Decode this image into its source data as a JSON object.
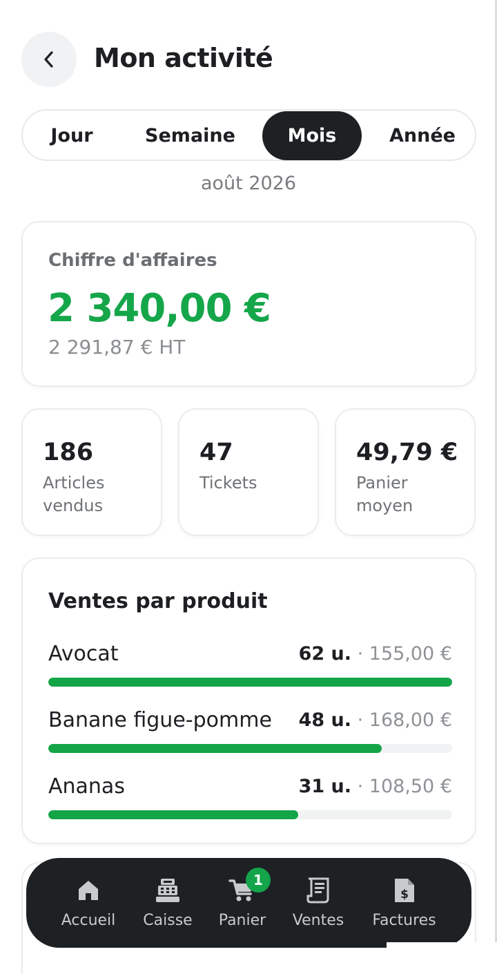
{
  "header": {
    "title": "Mon activité",
    "back_icon": "chevron-left-icon"
  },
  "periods": {
    "options": [
      "Jour",
      "Semaine",
      "Mois",
      "Année"
    ],
    "selected": "Mois"
  },
  "period_label": "août 2026",
  "revenue": {
    "label": "Chiffre d'affaires",
    "amount": "2 340,00 €",
    "ht": "2 291,87 € HT"
  },
  "stats": [
    {
      "value": "186",
      "label": "Articles vendus"
    },
    {
      "value": "47",
      "label": "Tickets"
    },
    {
      "value": "49,79 €",
      "label": "Panier moyen"
    }
  ],
  "products": {
    "title": "Ventes par produit",
    "items": [
      {
        "name": "Avocat",
        "units": "62 u.",
        "sep": " · ",
        "amount": "155,00 €",
        "share": 1.0
      },
      {
        "name": "Banane figue-pomme",
        "units": "48 u.",
        "sep": " · ",
        "amount": "168,00 €",
        "share": 0.826
      },
      {
        "name": "Ananas",
        "units": "31 u.",
        "sep": " · ",
        "amount": "108,50 €",
        "share": 0.619
      }
    ]
  },
  "nav": {
    "items": [
      {
        "label": "Accueil",
        "icon": "home-icon"
      },
      {
        "label": "Caisse",
        "icon": "cash-register-icon"
      },
      {
        "label": "Panier",
        "icon": "cart-icon",
        "badge": "1"
      },
      {
        "label": "Ventes",
        "icon": "receipt-icon"
      },
      {
        "label": "Factures",
        "icon": "invoice-icon"
      }
    ]
  },
  "colors": {
    "accent": "#15a64a",
    "dark": "#1e2124"
  }
}
